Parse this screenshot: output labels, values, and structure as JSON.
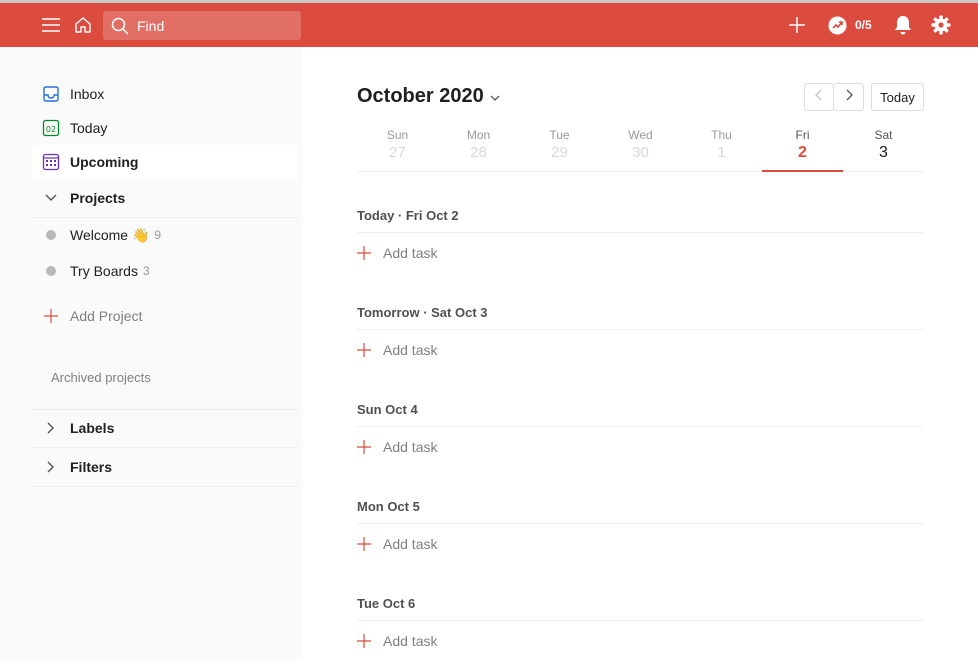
{
  "topbar": {
    "search_placeholder": "Find",
    "karma": "0/5",
    "icons": [
      "menu-icon",
      "home-icon",
      "search-icon",
      "plus-icon",
      "karma-icon",
      "bell-icon",
      "gear-icon"
    ],
    "color": "#db4c3f"
  },
  "sidebar": {
    "nav": [
      {
        "label": "Inbox",
        "icon": "inbox-icon"
      },
      {
        "label": "Today",
        "icon": "today-calendar-icon",
        "icon_text": "02"
      },
      {
        "label": "Upcoming",
        "icon": "upcoming-calendar-icon"
      }
    ],
    "projects_header": "Projects",
    "projects": [
      {
        "name": "Welcome 👋",
        "count": "9"
      },
      {
        "name": "Try Boards",
        "count": "3"
      }
    ],
    "add_project": "Add Project",
    "archived": "Archived projects",
    "labels": "Labels",
    "filters": "Filters"
  },
  "main": {
    "title": "October 2020",
    "today_button": "Today",
    "week": [
      {
        "name": "Sun",
        "date": "27"
      },
      {
        "name": "Mon",
        "date": "28"
      },
      {
        "name": "Tue",
        "date": "29"
      },
      {
        "name": "Wed",
        "date": "30"
      },
      {
        "name": "Thu",
        "date": "1"
      },
      {
        "name": "Fri",
        "date": "2"
      },
      {
        "name": "Sat",
        "date": "3"
      }
    ],
    "sections": [
      {
        "title": "Today · Fri Oct 2",
        "add": "Add task"
      },
      {
        "title": "Tomorrow · Sat Oct 3",
        "add": "Add task"
      },
      {
        "title": "Sun Oct 4",
        "add": "Add task"
      },
      {
        "title": "Mon Oct 5",
        "add": "Add task"
      },
      {
        "title": "Tue Oct 6",
        "add": "Add task"
      }
    ]
  }
}
